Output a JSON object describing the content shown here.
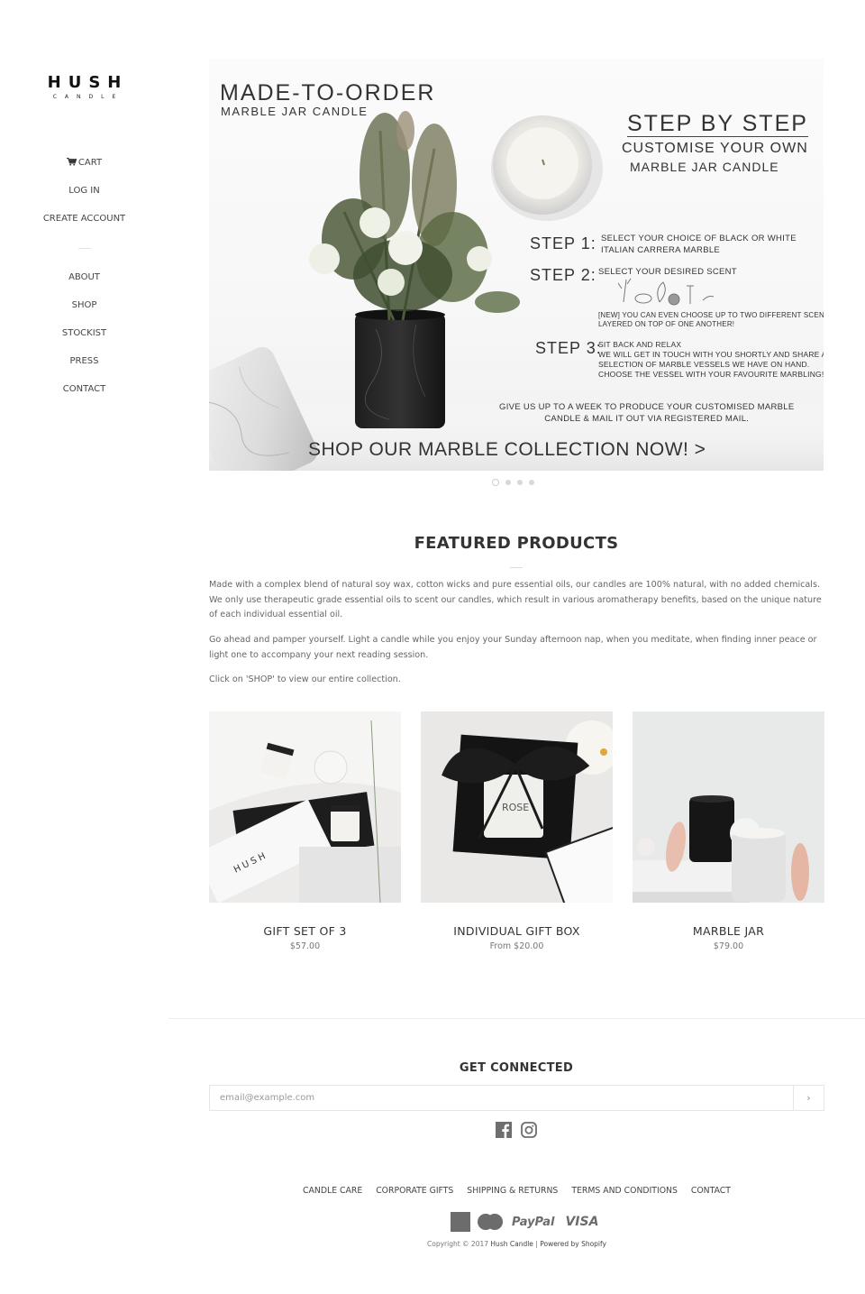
{
  "logo": {
    "name": "HUSH",
    "sub": "CANDLE"
  },
  "sidebar": {
    "top_items": [
      {
        "label": "CART",
        "icon": "cart-icon"
      },
      {
        "label": "LOG IN"
      },
      {
        "label": "CREATE ACCOUNT"
      }
    ],
    "main_items": [
      {
        "label": "ABOUT"
      },
      {
        "label": "SHOP"
      },
      {
        "label": "STOCKIST"
      },
      {
        "label": "PRESS"
      },
      {
        "label": "CONTACT"
      }
    ]
  },
  "hero": {
    "title": "MADE-TO-ORDER",
    "subtitle": "MARBLE JAR CANDLE",
    "steps_title": "STEP BY STEP",
    "steps_sub1": "CUSTOMISE YOUR OWN",
    "steps_sub2": "MARBLE JAR CANDLE",
    "step1_label": "STEP 1:",
    "step1_text_line1": "SELECT YOUR CHOICE OF BLACK OR WHITE",
    "step1_text_line2": "ITALIAN CARRERA MARBLE",
    "step2_label": "STEP 2:",
    "step2_text": "SELECT YOUR DESIRED SCENT",
    "step2_note_line1": "[NEW] YOU CAN EVEN CHOOSE UP TO TWO DIFFERENT SCENTS,",
    "step2_note_line2": "LAYERED ON TOP OF ONE ANOTHER!",
    "step3_label": "STEP 3:",
    "step3_line1": "SIT BACK AND RELAX",
    "step3_line2": "WE WILL GET IN TOUCH WITH YOU SHORTLY AND SHARE A",
    "step3_line3": "SELECTION OF MARBLE VESSELS WE HAVE ON HAND.",
    "step3_line4": "CHOOSE THE VESSEL WITH YOUR FAVOURITE MARBLING!",
    "give_line1": "GIVE US UP TO A WEEK TO PRODUCE YOUR CUSTOMISED MARBLE",
    "give_line2": "CANDLE & MAIL IT OUT VIA REGISTERED MAIL.",
    "cta": "SHOP OUR MARBLE COLLECTION NOW! >",
    "slide_count": 4,
    "active_slide": 1
  },
  "featured": {
    "title": "FEATURED PRODUCTS",
    "paragraphs": [
      "Made with a complex blend of natural soy wax, cotton wicks and pure essential oils, our candles are 100% natural, with no added chemicals. We only use therapeutic grade essential oils to scent our candles, which result in various aromatherapy benefits, based on the unique nature of each individual essential oil.",
      "Go ahead and pamper yourself. Light a candle while you enjoy your Sunday afternoon nap, when you meditate, when finding inner peace or light one to accompany your next reading session.",
      "Click on 'SHOP' to view our entire collection."
    ],
    "products": [
      {
        "title": "GIFT SET OF 3",
        "price": "$57.00"
      },
      {
        "title": "INDIVIDUAL GIFT BOX",
        "price": "From $20.00"
      },
      {
        "title": "MARBLE JAR",
        "price": "$79.00"
      }
    ]
  },
  "footer": {
    "connected_title": "GET CONNECTED",
    "email_placeholder": "email@example.com",
    "submit_label": "›",
    "social": [
      "facebook-icon",
      "instagram-icon"
    ],
    "links": [
      "CANDLE CARE",
      "CORPORATE GIFTS",
      "SHIPPING & RETURNS",
      "TERMS AND CONDITIONS",
      "CONTACT"
    ],
    "payments": [
      "American Express",
      "MasterCard",
      "PayPal",
      "VISA"
    ],
    "paypal_label": "PayPal",
    "visa_label": "VISA",
    "copyright_prefix": "Copyright © 2017",
    "brand_link": "Hush Candle",
    "separator": "|",
    "powered_by": "Powered by Shopify"
  }
}
